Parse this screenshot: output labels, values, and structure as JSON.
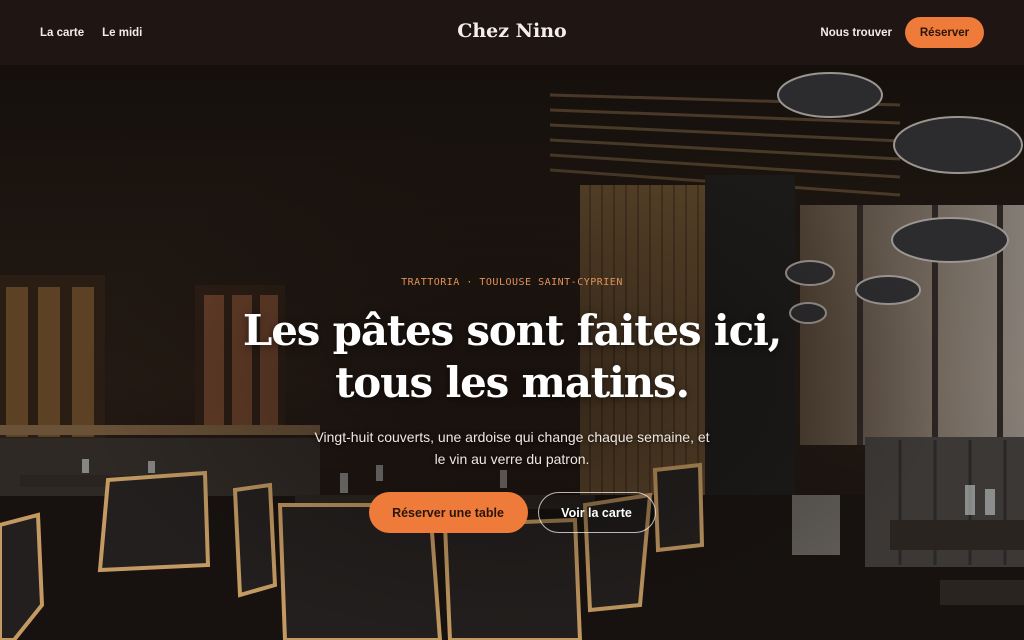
{
  "nav": {
    "links": [
      "La carte",
      "Le midi"
    ],
    "brand": "Chez Nino",
    "find_label": "Nous trouver",
    "reserve_label": "Réserver"
  },
  "hero": {
    "eyebrow": "TRATTORIA · TOULOUSE SAINT-CYPRIEN",
    "title_line1": "Les pâtes sont faites ici,",
    "title_line2": "tous les matins.",
    "subtitle": "Vingt-huit couverts, une ardoise qui change chaque semaine, et le vin au verre du patron.",
    "primary_cta": "Réserver une table",
    "secondary_cta": "Voir la carte",
    "image": "restaurant-interior-photo"
  },
  "colors": {
    "nav_bg": "#1f1512",
    "accent": "#ee7b3a",
    "eyebrow": "#e0925a"
  }
}
